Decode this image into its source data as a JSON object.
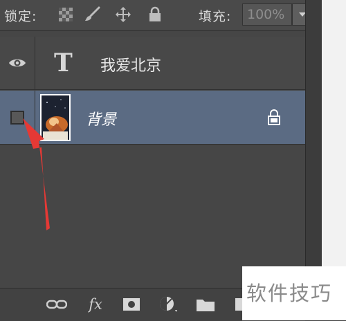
{
  "lockbar": {
    "lock_label": "锁定:",
    "fill_label": "填充:",
    "fill_value": "100%",
    "icons": [
      "lock-transparent-pixels-icon",
      "lock-image-pixels-icon",
      "lock-position-icon",
      "lock-all-icon"
    ]
  },
  "layers": [
    {
      "name": "我爱北京",
      "type": "text",
      "visible": true,
      "type_icon": "T"
    },
    {
      "name": "背景",
      "type": "background",
      "visible": false,
      "selected": true,
      "locked": true
    }
  ],
  "toolbar": {
    "fx_label": "fx",
    "icons": [
      "link-layers-icon",
      "layer-style-icon",
      "add-mask-icon",
      "adjustment-layer-icon",
      "new-group-icon",
      "new-layer-icon"
    ]
  },
  "watermark": {
    "text": "软件技巧"
  },
  "colors": {
    "panel": "#464646",
    "selected_row": "#5b6b83",
    "arrow": "#e53935"
  }
}
